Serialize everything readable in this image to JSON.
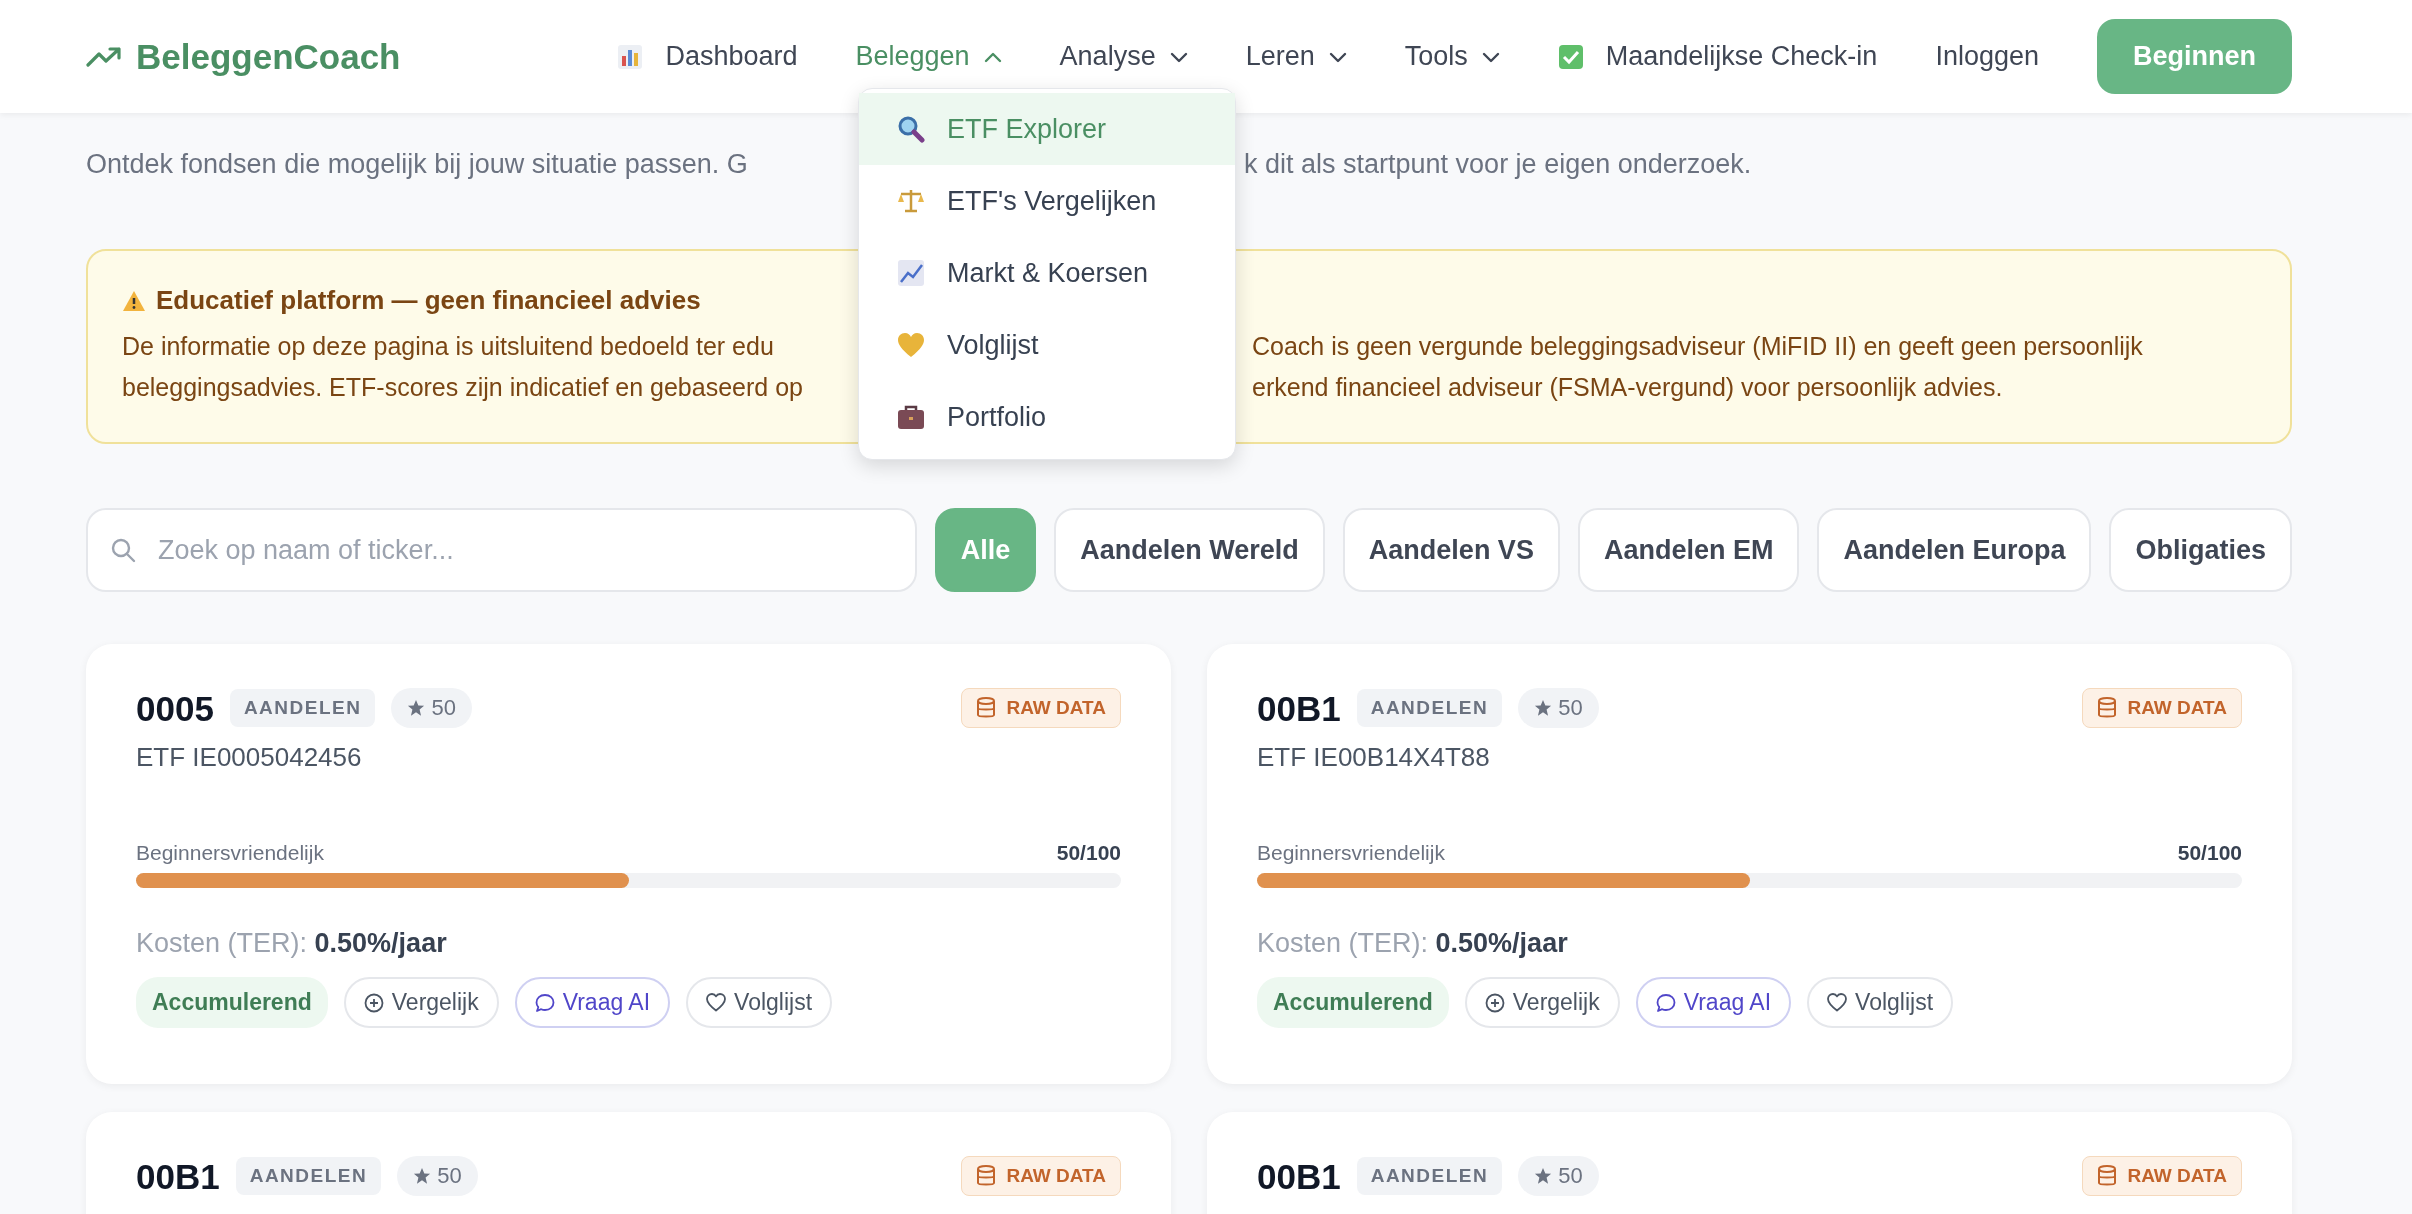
{
  "header": {
    "logo": "BeleggenCoach",
    "nav": [
      {
        "label": "Dashboard",
        "kind": "icon"
      },
      {
        "label": "Beleggen",
        "kind": "menu",
        "expanded": true
      },
      {
        "label": "Analyse",
        "kind": "menu",
        "expanded": false
      },
      {
        "label": "Leren",
        "kind": "menu",
        "expanded": false
      },
      {
        "label": "Tools",
        "kind": "menu",
        "expanded": false
      },
      {
        "label": "Maandelijkse Check-in",
        "kind": "icon"
      },
      {
        "label": "Inloggen",
        "kind": "link"
      }
    ],
    "cta": "Beginnen",
    "dropdown": [
      {
        "label": "ETF Explorer",
        "selected": true
      },
      {
        "label": "ETF's Vergelijken",
        "selected": false
      },
      {
        "label": "Markt & Koersen",
        "selected": false
      },
      {
        "label": "Volglijst",
        "selected": false
      },
      {
        "label": "Portfolio",
        "selected": false
      }
    ]
  },
  "intro": [
    "Ontdek fondsen die mogelijk bij jouw situatie passen. G",
    "k dit als startpunt voor je eigen onderzoek."
  ],
  "notice": {
    "title": "Educatief platform — geen financieel advies",
    "lines": [
      [
        "De informatie op deze pagina is uitsluitend bedoeld ter edu",
        "Coach is geen vergunde beleggingsadviseur (MiFID II) en geeft geen persoonlijk"
      ],
      [
        "beleggingsadvies. ETF-scores zijn indicatief en gebaseerd op",
        "erkend financieel adviseur (FSMA-vergund) voor persoonlijk advies."
      ]
    ]
  },
  "search": {
    "placeholder": "Zoek op naam of ticker..."
  },
  "filters": [
    {
      "label": "Alle",
      "selected": true
    },
    {
      "label": "Aandelen Wereld",
      "selected": false
    },
    {
      "label": "Aandelen VS",
      "selected": false
    },
    {
      "label": "Aandelen EM",
      "selected": false
    },
    {
      "label": "Aandelen Europa",
      "selected": false
    },
    {
      "label": "Obligaties",
      "selected": false
    }
  ],
  "cards": [
    {
      "ticker": "0005",
      "category": "AANDELEN",
      "rating": "50",
      "badge": "RAW DATA",
      "name": "ETF IE0005042456",
      "score_label": "Beginnersvriendelijk",
      "score": "50/100",
      "level": 0.5,
      "cost_label": "Kosten (TER):",
      "cost": "0.50%/jaar",
      "tag": "Accumulerend",
      "actions": [
        {
          "label": "Vergelijk",
          "kind": "compare"
        },
        {
          "label": "Vraag AI",
          "kind": "ask"
        },
        {
          "label": "Volglijst",
          "kind": "watch"
        }
      ]
    },
    {
      "ticker": "00B1",
      "category": "AANDELEN",
      "rating": "50",
      "badge": "RAW DATA",
      "name": "ETF IE00B14X4T88",
      "score_label": "Beginnersvriendelijk",
      "score": "50/100",
      "level": 0.5,
      "cost_label": "Kosten (TER):",
      "cost": "0.50%/jaar",
      "tag": "Accumulerend",
      "actions": [
        {
          "label": "Vergelijk",
          "kind": "compare"
        },
        {
          "label": "Vraag AI",
          "kind": "ask"
        },
        {
          "label": "Volglijst",
          "kind": "watch"
        }
      ]
    },
    {
      "ticker": "00B1",
      "category": "AANDELEN",
      "rating": "50",
      "badge": "RAW DATA"
    },
    {
      "ticker": "00B1",
      "category": "AANDELEN",
      "rating": "50",
      "badge": "RAW DATA"
    }
  ]
}
